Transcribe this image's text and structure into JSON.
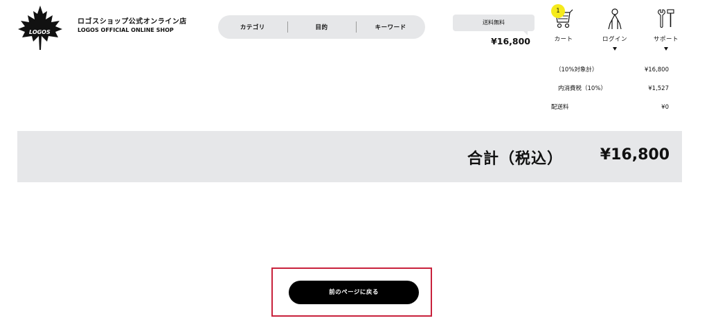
{
  "brand": {
    "name_jp": "ロゴスショップ公式オンライン店",
    "name_en": "LOGOS OFFICIAL ONLINE SHOP",
    "logo_text": "LOGOS"
  },
  "nav": {
    "items": [
      {
        "label": "カテゴリ"
      },
      {
        "label": "目的"
      },
      {
        "label": "キーワード"
      }
    ]
  },
  "header_cart": {
    "shipping_badge": "送料無料",
    "total": "¥16,800"
  },
  "icons": {
    "cart": {
      "label": "カート",
      "count": "1",
      "icon": "cart-icon"
    },
    "login": {
      "label": "ログイン",
      "icon": "person-icon"
    },
    "support": {
      "label": "サポート",
      "icon": "tools-icon"
    }
  },
  "breakdown": [
    {
      "label": "（10%対象計）",
      "value": "¥16,800"
    },
    {
      "label": "内消費税（10%）",
      "value": "¥1,527"
    },
    {
      "label": "配送料",
      "value": "¥0"
    }
  ],
  "total": {
    "label": "合計（税込）",
    "value": "¥16,800"
  },
  "back_button": {
    "label": "前のページに戻る"
  },
  "colors": {
    "accent_yellow": "#f5ea1c",
    "highlight_frame": "#c8213b",
    "panel_gray": "#e6e7e9"
  }
}
